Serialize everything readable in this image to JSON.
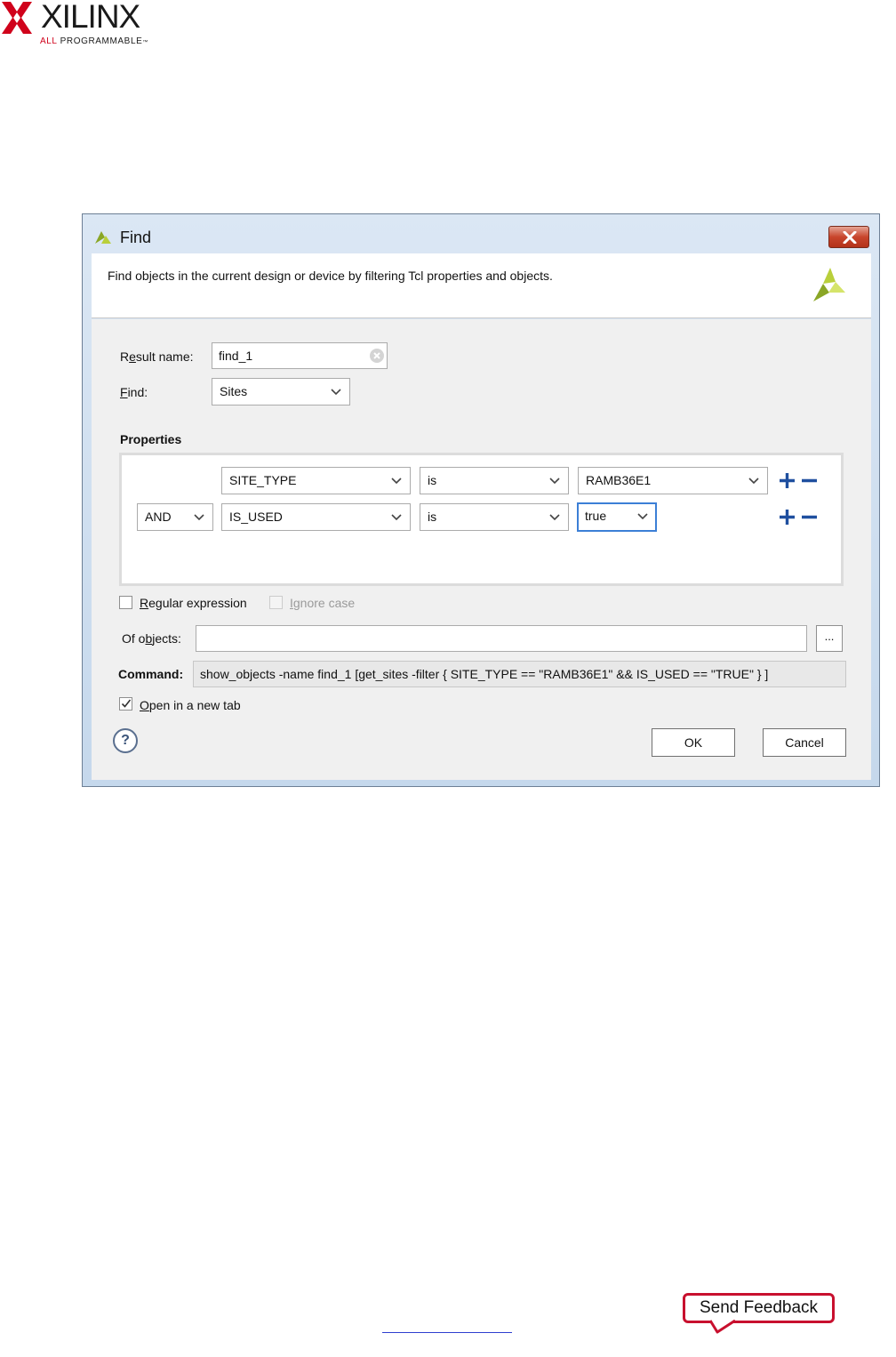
{
  "logo": {
    "wordmark": "XILINX",
    "tagline_prefix": "ALL",
    "tagline_rest": " PROGRAMMABLE",
    "brand_color": "#d0021b"
  },
  "dialog": {
    "title": "Find",
    "description": "Find objects in the current design or device by filtering Tcl properties and objects.",
    "result_name_label_pre": "R",
    "result_name_label_ul": "e",
    "result_name_label_post": "sult name:",
    "result_name_value": "find_1",
    "find_label_ul": "F",
    "find_label_post": "ind:",
    "find_value": "Sites",
    "properties_heading": "Properties",
    "rows": [
      {
        "operator": "",
        "property": "SITE_TYPE",
        "relation": "is",
        "value": "RAMB36E1"
      },
      {
        "operator": "AND",
        "property": "IS_USED",
        "relation": "is",
        "value": "true"
      }
    ],
    "regex_label_ul": "R",
    "regex_label_post": "egular expression",
    "ignore_case_label_ul": "I",
    "ignore_case_label_post": "gnore case",
    "of_objects_label_pre": "Of o",
    "of_objects_label_ul": "b",
    "of_objects_label_post": "jects:",
    "of_objects_value": "",
    "ellipsis_label": "...",
    "command_label": "Command:",
    "command_value": "show_objects -name find_1 [get_sites -filter { SITE_TYPE == \"RAMB36E1\" && IS_USED == \"TRUE\" } ]",
    "open_new_tab_label_ul": "O",
    "open_new_tab_label_post": "pen in a new tab",
    "open_new_tab_checked": true,
    "regex_checked": false,
    "help_label": "?",
    "ok_label": "OK",
    "cancel_label": "Cancel"
  },
  "footer": {
    "send_feedback_label": "Send Feedback"
  },
  "colors": {
    "focus_border": "#3c7fd6",
    "plus_minus": "#1f4f9f",
    "feedback_border": "#c8102e"
  }
}
